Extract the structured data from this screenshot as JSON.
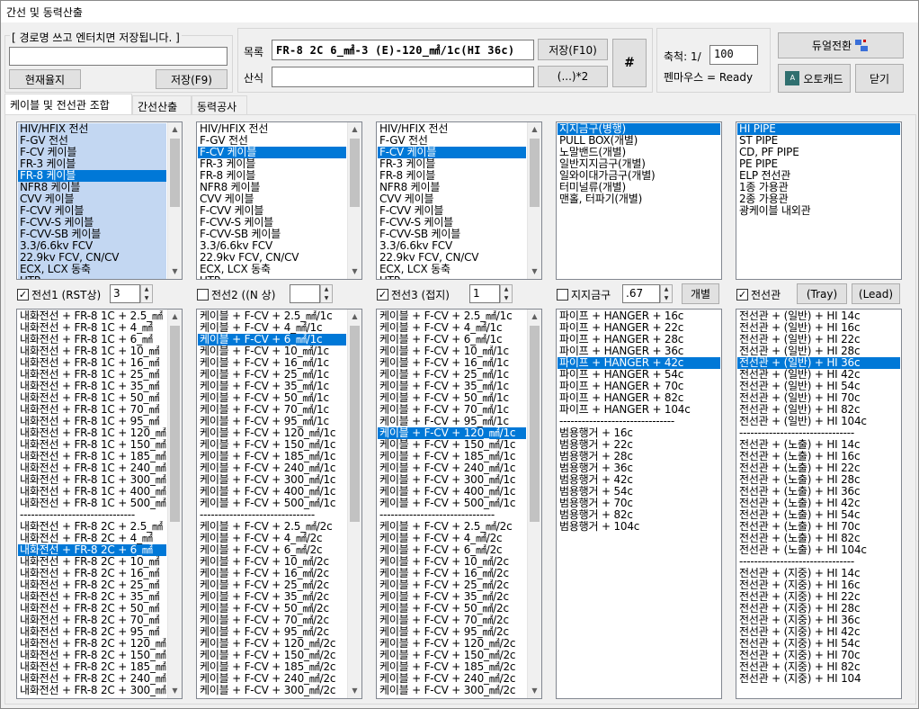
{
  "title": "간선 및 동력산출",
  "path_group": {
    "label": "[ 경로명 쓰고 엔터치면 저장됩니다. ]",
    "value": "",
    "current_btn": "현재율지",
    "save_btn": "저장(F9)"
  },
  "list_label": "목록",
  "list_value": "FR-8 2C 6_㎟-3 (E)-120_㎟/1c(HI 36c)",
  "save_f10": "저장(F10)",
  "calc_label": "산식",
  "calc_value": "",
  "calc_btn": "(...)*2",
  "hash_btn": "#",
  "scale_label": "축척: 1/",
  "scale_value": "100",
  "pen_status": "펜마우스 = Ready",
  "dual_btn": "듀얼전환",
  "autocad_btn": "오토캐드",
  "close_btn": "닫기",
  "tabs": [
    "케이블 및 전선관 조합",
    "간선산출",
    "동력공사"
  ],
  "cable_types": [
    "HIV/HFIX 전선",
    "F-GV 전선",
    "F-CV 케이블",
    "FR-3 케이블",
    "FR-8 케이블",
    "NFR8 케이블",
    "CVV 케이블",
    "F-CVV 케이블",
    "F-CVV-S 케이블",
    "F-CVV-SB 케이블",
    "3.3/6.6kv FCV",
    "22.9kv FCV, CN/CV",
    "ECX, LCX 동축",
    "UTP"
  ],
  "support_types": [
    "지지금구(병행)",
    "PULL BOX(개별)",
    "노말밴드(개별)",
    "일반지지금구(개별)",
    "일와이대가금구(개별)",
    "터미널류(개별)",
    "맨홀, 터파기(개별)"
  ],
  "conduit_types": [
    "HI PIPE",
    "ST PIPE",
    "CD, PF PIPE",
    "PE PIPE",
    "ELP 전선관",
    "1종 가용관",
    "2종 가용관",
    "광케이블 내외관"
  ],
  "w1": {
    "label": "전선1 (RST상)",
    "value": "3",
    "checked": "✓"
  },
  "w2": {
    "label": "전선2 ((N 상)",
    "value": "",
    "checked": ""
  },
  "w3": {
    "label": "전선3 (접지)",
    "value": "1",
    "checked": "✓"
  },
  "sup": {
    "label": "지지금구",
    "value": ".67",
    "checked": "",
    "btn": "개별"
  },
  "con": {
    "label": "전선관",
    "checked": "✓",
    "tray_btn": "(Tray)",
    "lead_btn": "(Lead)"
  },
  "list1": [
    "내화전선 + FR-8 1C + 2.5_㎟",
    "내화전선 + FR-8 1C + 4_㎟",
    "내화전선 + FR-8 1C + 6_㎟",
    "내화전선 + FR-8 1C + 10_㎟",
    "내화전선 + FR-8 1C + 16_㎟",
    "내화전선 + FR-8 1C + 25_㎟",
    "내화전선 + FR-8 1C + 35_㎟",
    "내화전선 + FR-8 1C + 50_㎟",
    "내화전선 + FR-8 1C + 70_㎟",
    "내화전선 + FR-8 1C + 95_㎟",
    "내화전선 + FR-8 1C + 120_㎟",
    "내화전선 + FR-8 1C + 150_㎟",
    "내화전선 + FR-8 1C + 185_㎟",
    "내화전선 + FR-8 1C + 240_㎟",
    "내화전선 + FR-8 1C + 300_㎟",
    "내화전선 + FR-8 1C + 400_㎟",
    "내화전선 + FR-8 1C + 500_㎟",
    "-------------------------------",
    "내화전선 + FR-8 2C + 2.5_㎟",
    "내화전선 + FR-8 2C + 4_㎟",
    "내화전선 + FR-8 2C + 6_㎟",
    "내화전선 + FR-8 2C + 10_㎟",
    "내화전선 + FR-8 2C + 16_㎟",
    "내화전선 + FR-8 2C + 25_㎟",
    "내화전선 + FR-8 2C + 35_㎟",
    "내화전선 + FR-8 2C + 50_㎟",
    "내화전선 + FR-8 2C + 70_㎟",
    "내화전선 + FR-8 2C + 95_㎟",
    "내화전선 + FR-8 2C + 120_㎟",
    "내화전선 + FR-8 2C + 150_㎟",
    "내화전선 + FR-8 2C + 185_㎟",
    "내화전선 + FR-8 2C + 240_㎟",
    "내화전선 + FR-8 2C + 300_㎟"
  ],
  "list2": [
    "케이블 + F-CV + 2.5_㎟/1c",
    "케이블 + F-CV + 4_㎟/1c",
    "케이블 + F-CV + 6_㎟/1c",
    "케이블 + F-CV + 10_㎟/1c",
    "케이블 + F-CV + 16_㎟/1c",
    "케이블 + F-CV + 25_㎟/1c",
    "케이블 + F-CV + 35_㎟/1c",
    "케이블 + F-CV + 50_㎟/1c",
    "케이블 + F-CV + 70_㎟/1c",
    "케이블 + F-CV + 95_㎟/1c",
    "케이블 + F-CV + 120_㎟/1c",
    "케이블 + F-CV + 150_㎟/1c",
    "케이블 + F-CV + 185_㎟/1c",
    "케이블 + F-CV + 240_㎟/1c",
    "케이블 + F-CV + 300_㎟/1c",
    "케이블 + F-CV + 400_㎟/1c",
    "케이블 + F-CV + 500_㎟/1c",
    "-------------------------------",
    "케이블 + F-CV + 2.5_㎟/2c",
    "케이블 + F-CV + 4_㎟/2c",
    "케이블 + F-CV + 6_㎟/2c",
    "케이블 + F-CV + 10_㎟/2c",
    "케이블 + F-CV + 16_㎟/2c",
    "케이블 + F-CV + 25_㎟/2c",
    "케이블 + F-CV + 35_㎟/2c",
    "케이블 + F-CV + 50_㎟/2c",
    "케이블 + F-CV + 70_㎟/2c",
    "케이블 + F-CV + 95_㎟/2c",
    "케이블 + F-CV + 120_㎟/2c",
    "케이블 + F-CV + 150_㎟/2c",
    "케이블 + F-CV + 185_㎟/2c",
    "케이블 + F-CV + 240_㎟/2c",
    "케이블 + F-CV + 300_㎟/2c"
  ],
  "list4": [
    "파이프 + HANGER + 16c",
    "파이프 + HANGER + 22c",
    "파이프 + HANGER + 28c",
    "파이프 + HANGER + 36c",
    "파이프 + HANGER + 42c",
    "파이프 + HANGER + 54c",
    "파이프 + HANGER + 70c",
    "파이프 + HANGER + 82c",
    "파이프 + HANGER + 104c",
    "-------------------------------",
    "범용행거 + 16c",
    "범용행거 + 22c",
    "범용행거 + 28c",
    "범용행거 + 36c",
    "범용행거 + 42c",
    "범용행거 + 54c",
    "범용행거 + 70c",
    "범용행거 + 82c",
    "범용행거 + 104c"
  ],
  "list5": [
    "전선관 + (일반) + HI 14c",
    "전선관 + (일반) + HI 16c",
    "전선관 + (일반) + HI 22c",
    "전선관 + (일반) + HI 28c",
    "전선관 + (일반) + HI 36c",
    "전선관 + (일반) + HI 42c",
    "전선관 + (일반) + HI 54c",
    "전선관 + (일반) + HI 70c",
    "전선관 + (일반) + HI 82c",
    "전선관 + (일반) + HI 104c",
    "-------------------------------",
    "전선관 + (노출) + HI 14c",
    "전선관 + (노출) + HI 16c",
    "전선관 + (노출) + HI 22c",
    "전선관 + (노출) + HI 28c",
    "전선관 + (노출) + HI 36c",
    "전선관 + (노출) + HI 42c",
    "전선관 + (노출) + HI 54c",
    "전선관 + (노출) + HI 70c",
    "전선관 + (노출) + HI 82c",
    "전선관 + (노출) + HI 104c",
    "-------------------------------",
    "전선관 + (지중) + HI 14c",
    "전선관 + (지중) + HI 16c",
    "전선관 + (지중) + HI 22c",
    "전선관 + (지중) + HI 28c",
    "전선관 + (지중) + HI 36c",
    "전선관 + (지중) + HI 42c",
    "전선관 + (지중) + HI 54c",
    "전선관 + (지중) + HI 70c",
    "전선관 + (지중) + HI 82c",
    "전선관 + (지중) + HI 104"
  ]
}
